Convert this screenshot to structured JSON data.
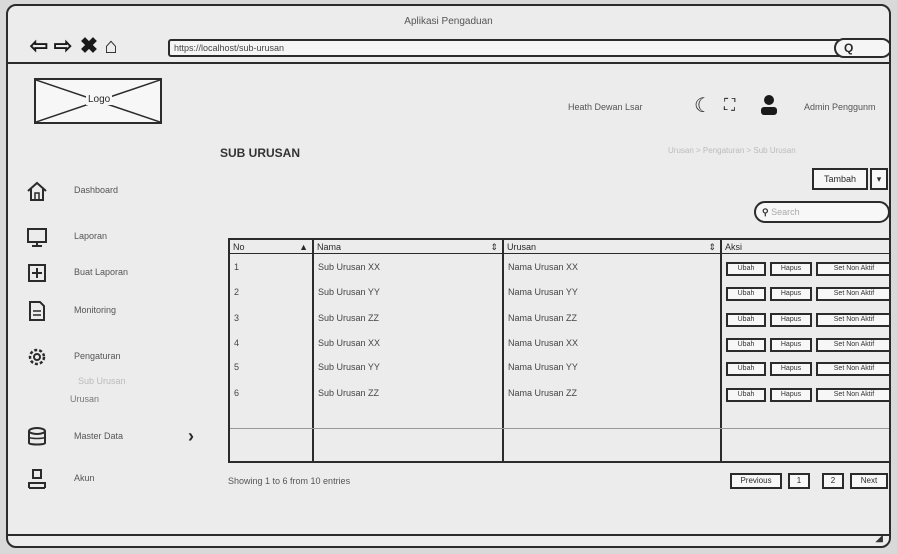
{
  "window": {
    "title": "Aplikasi Pengaduan"
  },
  "browser": {
    "url": "https://localhost/sub-urusan",
    "search_label": "Q",
    "icons": {
      "back": "arrow-left-icon",
      "forward": "arrow-right-icon",
      "close": "close-icon",
      "home": "home-icon"
    }
  },
  "header": {
    "logo": "Logo",
    "notif_text": "Heath Dewan Lsar",
    "user_name": "Admin Penggunm",
    "icons": {
      "theme": "moon-icon",
      "fullscreen": "fullscreen-icon",
      "user": "user-icon"
    }
  },
  "sidebar": {
    "items": [
      {
        "label": "Dashboard",
        "icon": "home-icon"
      },
      {
        "label": "Laporan",
        "icon": "monitor-icon"
      },
      {
        "label": "Buat Laporan",
        "icon": "plus-box-icon"
      },
      {
        "label": "Monitoring",
        "icon": "document-icon"
      },
      {
        "label": "Pengaturan",
        "icon": "gear-icon"
      },
      {
        "label": "Master Data",
        "icon": "database-icon"
      },
      {
        "label": "Akun",
        "icon": "account-icon"
      }
    ],
    "sub_items": [
      "Sub Urusan",
      "Urusan"
    ]
  },
  "main": {
    "title": "SUB URUSAN",
    "breadcrumb": "Urusan > Pengaturan > Sub Urusan",
    "add_button": "Tambah",
    "add_dropdown": "▾",
    "search_placeholder": "Search",
    "table": {
      "columns": [
        "No",
        "Nama",
        "Urusan",
        "Aksi"
      ],
      "rows": [
        {
          "no": "1",
          "nama": "Sub Urusan XX",
          "urusan": "Nama Urusan XX"
        },
        {
          "no": "2",
          "nama": "Sub Urusan YY",
          "urusan": "Nama Urusan YY"
        },
        {
          "no": "3",
          "nama": "Sub Urusan ZZ",
          "urusan": "Nama Urusan ZZ"
        },
        {
          "no": "4",
          "nama": "Sub Urusan XX",
          "urusan": "Nama Urusan XX"
        },
        {
          "no": "5",
          "nama": "Sub Urusan YY",
          "urusan": "Nama Urusan YY"
        },
        {
          "no": "6",
          "nama": "Sub Urusan ZZ",
          "urusan": "Nama Urusan ZZ"
        }
      ],
      "actions": [
        "Ubah",
        "Hapus",
        "Set Non Aktif"
      ]
    },
    "footer": {
      "info": "Showing 1 to 6 from 10 entries",
      "pagination": [
        "Previous",
        "1",
        "2",
        "Next"
      ]
    }
  }
}
